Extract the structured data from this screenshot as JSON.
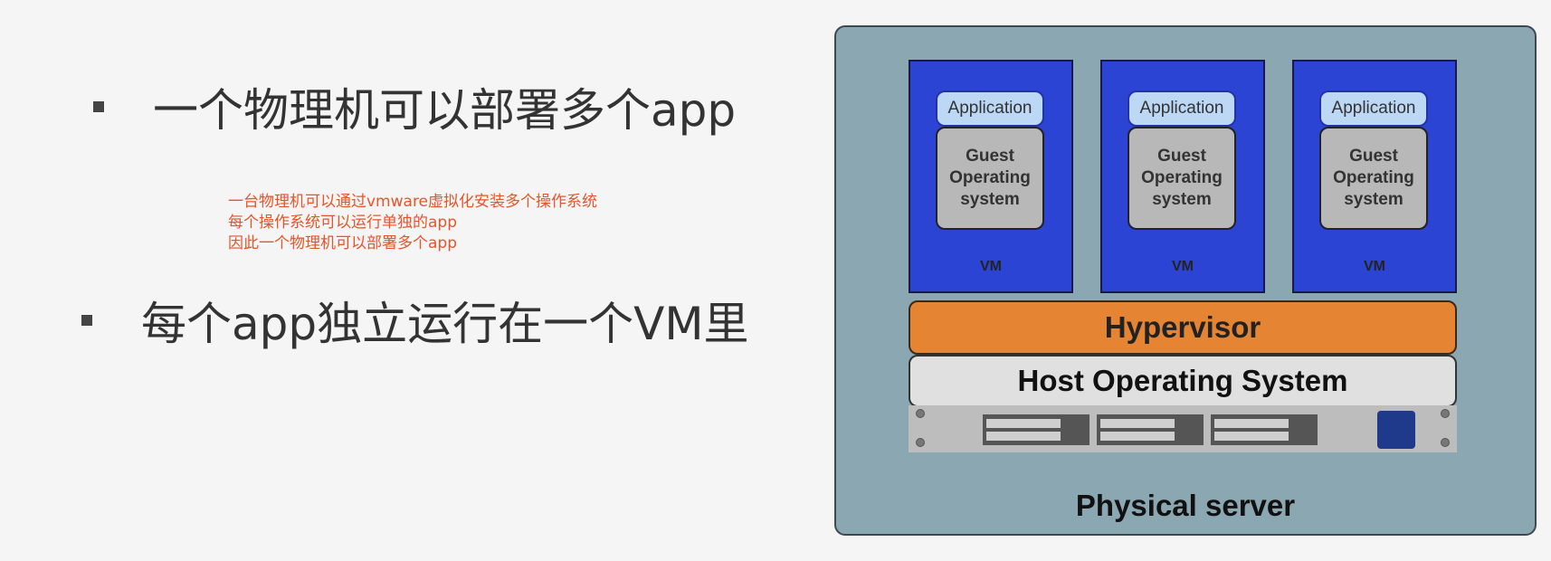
{
  "bullets": [
    {
      "text": "一个物理机可以部署多个app"
    },
    {
      "text": "每个app独立运行在一个VM里"
    }
  ],
  "note_lines": [
    "一台物理机可以通过vmware虚拟化安装多个操作系统",
    "每个操作系统可以运行单独的app",
    "因此一个物理机可以部署多个app"
  ],
  "diagram": {
    "vms": [
      {
        "app": "Application",
        "guest": "Guest\nOperating\nsystem",
        "label": "VM"
      },
      {
        "app": "Application",
        "guest": "Guest\nOperating\nsystem",
        "label": "VM"
      },
      {
        "app": "Application",
        "guest": "Guest\nOperating\nsystem",
        "label": "VM"
      }
    ],
    "hypervisor": "Hypervisor",
    "host_os": "Host Operating System",
    "physical_server": "Physical server",
    "colors": {
      "background": "#8aa7b2",
      "vm": "#2b44d4",
      "application": "#bcd8f5",
      "guest_os": "#b8b8b8",
      "hypervisor": "#e58533",
      "host_os": "#e0e0e0",
      "note_text": "#e8542a"
    }
  }
}
